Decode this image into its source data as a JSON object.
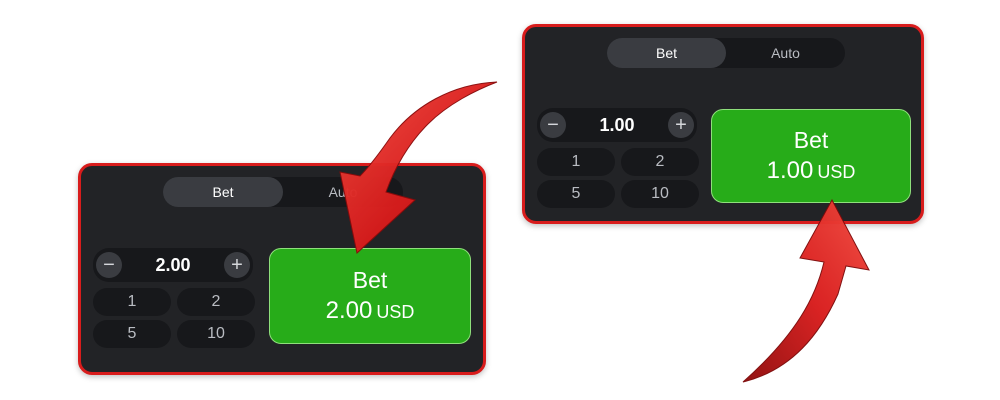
{
  "colors": {
    "panel_bg": "#222326",
    "panel_border": "#d81c1c",
    "bet_button": "#27ac19",
    "arrow": "#d81c1c"
  },
  "panel_left": {
    "tabs": [
      {
        "label": "Bet",
        "active": true
      },
      {
        "label": "Auto",
        "active": false
      }
    ],
    "amount": "2.00",
    "decrement_icon": "minus-icon",
    "increment_icon": "plus-icon",
    "quick_amounts": [
      "1",
      "2",
      "5",
      "10"
    ],
    "bet_button": {
      "label": "Bet",
      "amount": "2.00",
      "currency": "USD"
    }
  },
  "panel_right": {
    "tabs": [
      {
        "label": "Bet",
        "active": true
      },
      {
        "label": "Auto",
        "active": false
      }
    ],
    "amount": "1.00",
    "decrement_icon": "minus-icon",
    "increment_icon": "plus-icon",
    "quick_amounts": [
      "1",
      "2",
      "5",
      "10"
    ],
    "bet_button": {
      "label": "Bet",
      "amount": "1.00",
      "currency": "USD"
    }
  },
  "arrows": [
    "curved-arrow-down-icon",
    "curved-arrow-up-icon"
  ]
}
